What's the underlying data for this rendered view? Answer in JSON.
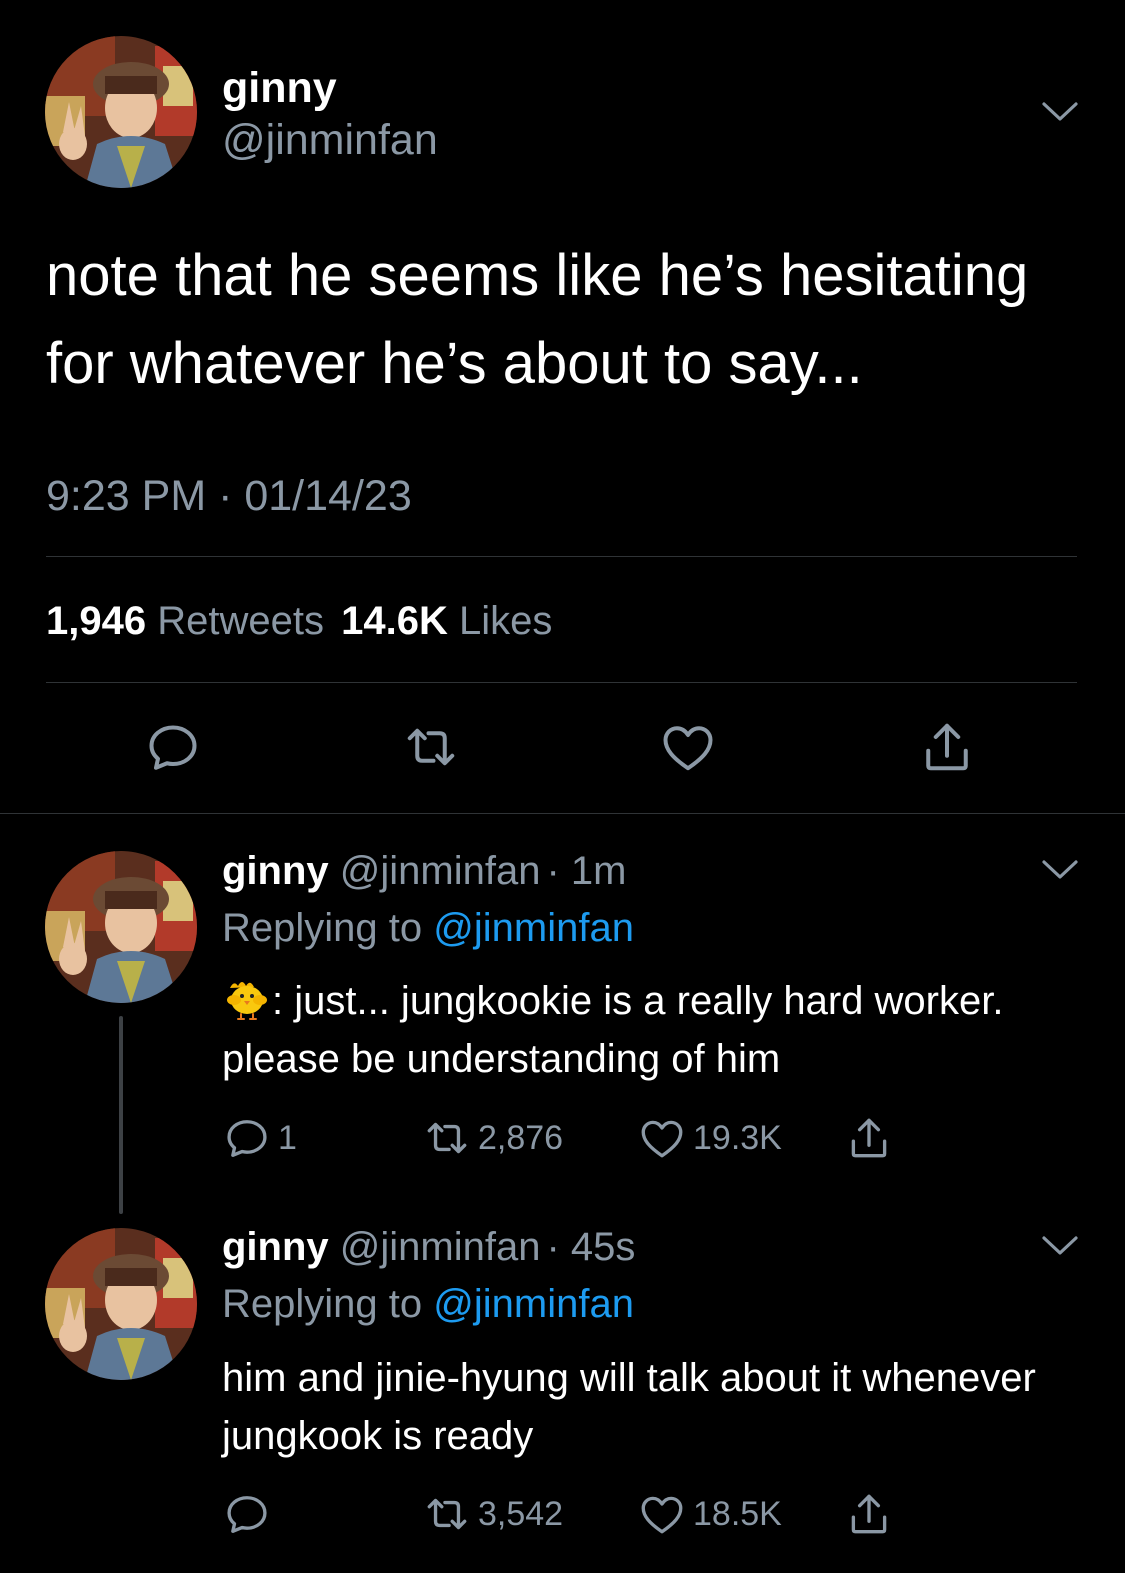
{
  "main_tweet": {
    "name": "ginny",
    "handle": "@jinminfan",
    "text": "note that he seems like he’s hesitating for whatever he’s about to say...",
    "timestamp": "9:23 PM · 01/14/23",
    "retweets_count": "1,946",
    "retweets_label": "Retweets",
    "likes_count": "14.6K",
    "likes_label": "Likes",
    "icons": [
      "comment-icon",
      "retweet-icon",
      "heart-icon",
      "share-icon"
    ]
  },
  "replies": [
    {
      "name": "ginny",
      "handle": "@jinminfan",
      "time": "· 1m",
      "replying_prefix": "Replying to",
      "replying_to": "@jinminfan",
      "emoji_icon": "baby-chick-emoji",
      "text": ": just... jungkookie is a really hard worker. please be understanding of him",
      "reply_count": "1",
      "retweet_count": "2,876",
      "like_count": "19.3K"
    },
    {
      "name": "ginny",
      "handle": "@jinminfan",
      "time": "· 45s",
      "replying_prefix": "Replying to",
      "replying_to": "@jinminfan",
      "text": "him and jinie-hyung will talk about it whenever jungkook is ready",
      "reply_count": "",
      "retweet_count": "3,542",
      "like_count": "18.5K"
    }
  ],
  "colors": {
    "background": "#000000",
    "text_primary": "#ffffff",
    "text_secondary": "#8b98a5",
    "link": "#1d9bf0",
    "divider": "#2f3336"
  }
}
